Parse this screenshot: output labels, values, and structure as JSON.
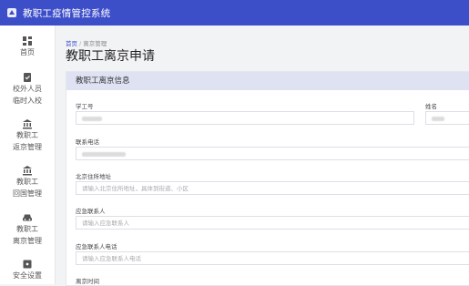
{
  "app": {
    "title": "教职工疫情管控系统"
  },
  "sidebar": {
    "items": [
      {
        "lines": [
          "首页"
        ],
        "icon": "dashboard-icon"
      },
      {
        "lines": [
          "校外人员",
          "临时入校"
        ],
        "icon": "checklist-icon"
      },
      {
        "lines": [
          "教职工",
          "返京管理"
        ],
        "icon": "bank-icon"
      },
      {
        "lines": [
          "教职工",
          "回国管理"
        ],
        "icon": "bank-icon"
      },
      {
        "lines": [
          "教职工",
          "离京管理"
        ],
        "icon": "car-icon"
      },
      {
        "lines": [
          "安全设置"
        ],
        "icon": "lock-icon"
      }
    ]
  },
  "breadcrumb": {
    "home": "首页",
    "separator": "/",
    "current": "离京管理"
  },
  "page": {
    "title": "教职工离京申请"
  },
  "form": {
    "section_title": "教职工离京信息",
    "fields": {
      "staff_id": {
        "label": "学工号"
      },
      "name": {
        "label": "姓名"
      },
      "phone": {
        "label": "联系电话"
      },
      "address": {
        "label": "北京住所地址",
        "placeholder": "请输入北京住所地址，具体到街道、小区"
      },
      "emergency_contact": {
        "label": "应急联系人",
        "placeholder": "请输入应急联系人"
      },
      "emergency_phone": {
        "label": "应急联系人电话",
        "placeholder": "请输入应急联系人电话"
      },
      "departure_time": {
        "label": "离京时间"
      }
    }
  },
  "colors": {
    "topbar": "#3d4ec9",
    "card_header": "#dfe2f3"
  }
}
